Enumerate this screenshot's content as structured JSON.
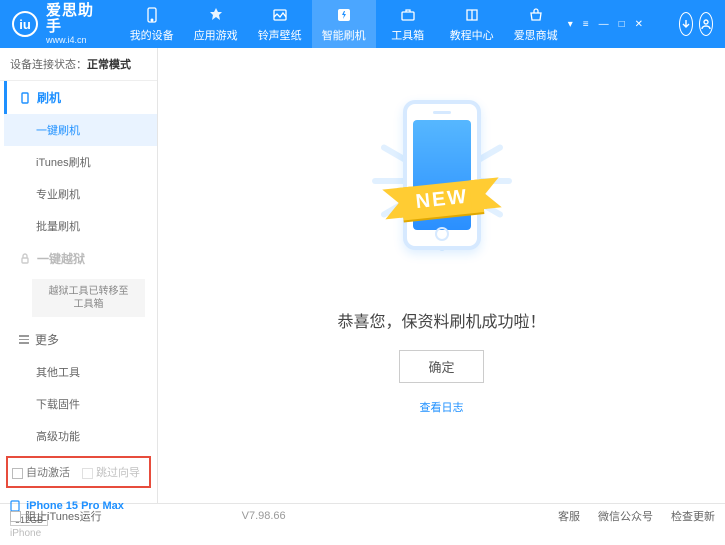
{
  "brand": {
    "logo_letter": "iu",
    "title": "爱思助手",
    "subtitle": "www.i4.cn"
  },
  "nav": [
    {
      "label": "我的设备"
    },
    {
      "label": "应用游戏"
    },
    {
      "label": "铃声壁纸"
    },
    {
      "label": "智能刷机"
    },
    {
      "label": "工具箱"
    },
    {
      "label": "教程中心"
    },
    {
      "label": "爱思商城"
    }
  ],
  "status": {
    "label": "设备连接状态：",
    "value": "正常模式"
  },
  "sidebar": {
    "section1": {
      "header": "刷机",
      "items": [
        "一键刷机",
        "iTunes刷机",
        "专业刷机",
        "批量刷机"
      ]
    },
    "section2": {
      "header": "一键越狱",
      "note": "越狱工具已转移至\n工具箱"
    },
    "section3": {
      "header": "更多",
      "items": [
        "其他工具",
        "下载固件",
        "高级功能"
      ]
    },
    "checks": {
      "auto_activate": "自动激活",
      "skip_guide": "跳过向导"
    },
    "device": {
      "name": "iPhone 15 Pro Max",
      "capacity": "512GB",
      "type": "iPhone"
    }
  },
  "main": {
    "ribbon": "NEW",
    "message": "恭喜您，保资料刷机成功啦！",
    "ok": "确定",
    "view_log": "查看日志"
  },
  "footer": {
    "block_itunes": "阻止iTunes运行",
    "version": "V7.98.66",
    "links": [
      "客服",
      "微信公众号",
      "检查更新"
    ]
  }
}
